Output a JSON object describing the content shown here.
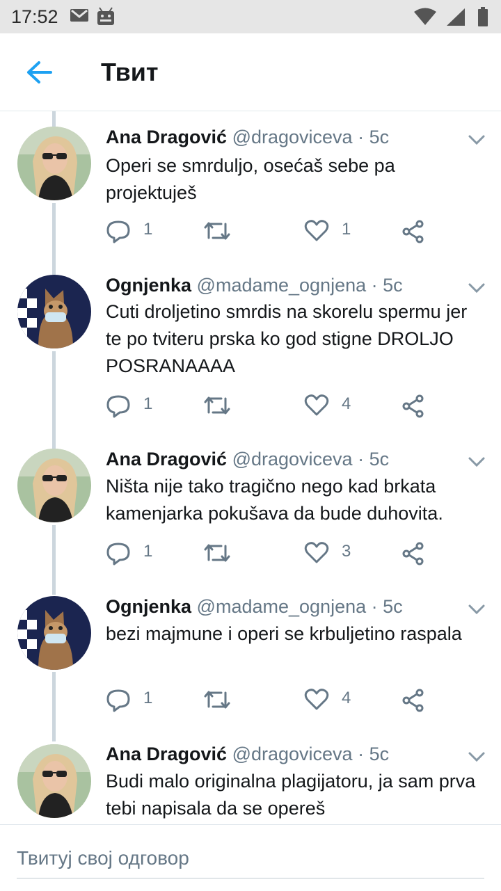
{
  "status_bar": {
    "time": "17:52",
    "icons": [
      "gmail-icon",
      "android-icon",
      "wifi-icon",
      "signal-icon",
      "battery-icon"
    ]
  },
  "header": {
    "title": "Твит",
    "back_icon": "arrow-left-icon",
    "accent_color": "#1da1f2"
  },
  "tweets": [
    {
      "name": "Ana Dragović",
      "handle": "@dragoviceva",
      "time": "5c",
      "text": "Operi se smrduljo, osećaš sebe pa projektuješ",
      "replies": "1",
      "retweets": "",
      "likes": "1",
      "avatar": "avatar-blonde"
    },
    {
      "name": "Ognjenka",
      "handle": "@madame_ognjena",
      "time": "5c",
      "text": "Cuti droljetino smrdis na skorelu spermu jer te po tviteru prska ko god stigne DROLJO POSRANAAAA",
      "replies": "1",
      "retweets": "",
      "likes": "4",
      "avatar": "avatar-mask"
    },
    {
      "name": "Ana Dragović",
      "handle": "@dragoviceva",
      "time": "5c",
      "text": "Ništa nije tako tragično nego kad brkata kamenjarka pokušava da bude duhovita.",
      "replies": "1",
      "retweets": "",
      "likes": "3",
      "avatar": "avatar-blonde"
    },
    {
      "name": "Ognjenka",
      "handle": "@madame_ognjena",
      "time": "5c",
      "text": "bezi majmune i operi se krbuljetino raspala",
      "replies": "1",
      "retweets": "",
      "likes": "4",
      "avatar": "avatar-mask"
    },
    {
      "name": "Ana Dragović",
      "handle": "@dragoviceva",
      "time": "5c",
      "text": "Budi malo originalna plagijatoru, ja sam prva tebi napisala da se opereš",
      "replies": "",
      "retweets": "",
      "likes": "",
      "avatar": "avatar-blonde"
    }
  ],
  "reply": {
    "placeholder": "Твитуј свој одговор"
  },
  "colors": {
    "text": "#14171a",
    "secondary": "#657786",
    "connector": "#ccd6dd",
    "divider": "#e1e8ed"
  }
}
